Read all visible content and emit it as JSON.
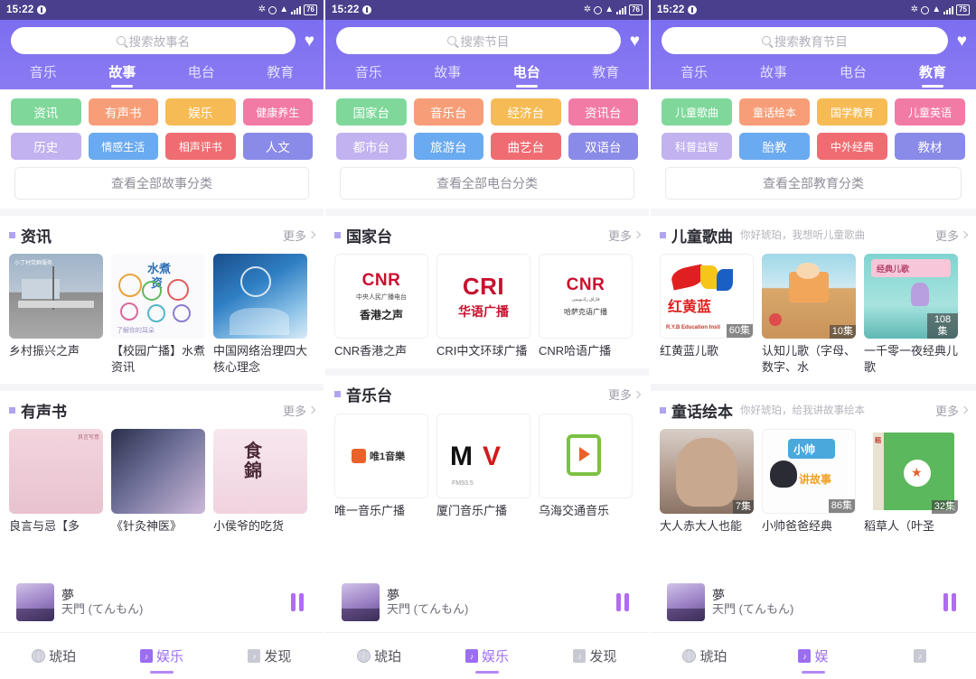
{
  "statusbar": {
    "time": "15:22",
    "battery_1": "76",
    "battery_2": "76",
    "battery_3": "75",
    "icons": [
      "info-icon",
      "bluetooth-icon",
      "alarm-icon",
      "wifi-icon",
      "signal-icon",
      "battery-icon"
    ]
  },
  "colors": {
    "header_purple": "#8b7bf2",
    "statusbar_purple": "#4a3f8c",
    "accent": "#9b6ef0",
    "chip_green": "#7fd89a",
    "chip_orange": "#f79e78",
    "chip_amber": "#f6bb54",
    "chip_pink": "#f27ba6",
    "chip_lavender": "#c3b2f0",
    "chip_blue": "#6aaaf0",
    "chip_red": "#ef6d72",
    "chip_indigo": "#8a8ae8"
  },
  "panels": [
    {
      "search_placeholder": "搜索故事名",
      "favorite_icon": "heart-icon",
      "tabs": [
        {
          "label": "音乐",
          "active": false
        },
        {
          "label": "故事",
          "active": true
        },
        {
          "label": "电台",
          "active": false
        },
        {
          "label": "教育",
          "active": false
        }
      ],
      "chips": [
        {
          "label": "资讯",
          "color": "#7fd89a"
        },
        {
          "label": "有声书",
          "color": "#f79e78"
        },
        {
          "label": "娱乐",
          "color": "#f6bb54"
        },
        {
          "label": "健康养生",
          "color": "#f27ba6"
        },
        {
          "label": "历史",
          "color": "#c3b2f0"
        },
        {
          "label": "情感生活",
          "color": "#6aaaf0"
        },
        {
          "label": "相声评书",
          "color": "#ef6d72"
        },
        {
          "label": "人文",
          "color": "#8a8ae8"
        }
      ],
      "view_all": "查看全部故事分类",
      "sections": [
        {
          "title": "资讯",
          "hint": "",
          "more": "更多",
          "cards": [
            {
              "title": "乡村振兴之声",
              "eps": ""
            },
            {
              "title": "【校园广播】水煮资讯",
              "eps": ""
            },
            {
              "title": "中国网络治理四大核心理念",
              "eps": ""
            }
          ]
        },
        {
          "title": "有声书",
          "hint": "",
          "more": "更多",
          "cards": [
            {
              "title": "良言与忌【多",
              "eps": ""
            },
            {
              "title": "《针灸神医》",
              "eps": ""
            },
            {
              "title": "小侯爷的吃货",
              "eps": ""
            }
          ]
        }
      ],
      "player": {
        "title": "夢",
        "artist": "天門 (てんもん)",
        "pause_icon": "pause-icon"
      },
      "bottomnav": [
        {
          "label": "琥珀",
          "icon": "globe-icon",
          "active": false
        },
        {
          "label": "娱乐",
          "icon": "book-icon",
          "active": true
        },
        {
          "label": "发现",
          "icon": "book-icon",
          "active": false
        }
      ]
    },
    {
      "search_placeholder": "搜索节目",
      "favorite_icon": "heart-icon",
      "tabs": [
        {
          "label": "音乐",
          "active": false
        },
        {
          "label": "故事",
          "active": false
        },
        {
          "label": "电台",
          "active": true
        },
        {
          "label": "教育",
          "active": false
        }
      ],
      "chips": [
        {
          "label": "国家台",
          "color": "#7fd89a"
        },
        {
          "label": "音乐台",
          "color": "#f79e78"
        },
        {
          "label": "经济台",
          "color": "#f6bb54"
        },
        {
          "label": "资讯台",
          "color": "#f27ba6"
        },
        {
          "label": "都市台",
          "color": "#c3b2f0"
        },
        {
          "label": "旅游台",
          "color": "#6aaaf0"
        },
        {
          "label": "曲艺台",
          "color": "#ef6d72"
        },
        {
          "label": "双语台",
          "color": "#8a8ae8"
        }
      ],
      "view_all": "查看全部电台分类",
      "sections": [
        {
          "title": "国家台",
          "hint": "",
          "more": "更多",
          "cards": [
            {
              "title": "CNR香港之声",
              "eps": "",
              "logo": "CNR",
              "sub": "中央人民广播电台",
              "sub2": "香港之声"
            },
            {
              "title": "CRI中文环球广播",
              "eps": "",
              "logo": "CRI",
              "sub": "华语广播"
            },
            {
              "title": "CNR哈语广播",
              "eps": "",
              "logo": "CNR",
              "sub": "哈萨克语广播"
            }
          ]
        },
        {
          "title": "音乐台",
          "hint": "",
          "more": "更多",
          "cards": [
            {
              "title": "唯一音乐广播",
              "eps": ""
            },
            {
              "title": "厦门音乐广播",
              "eps": ""
            },
            {
              "title": "乌海交通音乐",
              "eps": ""
            }
          ]
        }
      ],
      "player": {
        "title": "夢",
        "artist": "天門 (てんもん)",
        "pause_icon": "pause-icon"
      },
      "bottomnav": [
        {
          "label": "琥珀",
          "icon": "globe-icon",
          "active": false
        },
        {
          "label": "娱乐",
          "icon": "book-icon",
          "active": true
        },
        {
          "label": "发现",
          "icon": "book-icon",
          "active": false
        }
      ]
    },
    {
      "search_placeholder": "搜索教育节目",
      "favorite_icon": "heart-icon",
      "tabs": [
        {
          "label": "音乐",
          "active": false
        },
        {
          "label": "故事",
          "active": false
        },
        {
          "label": "电台",
          "active": false
        },
        {
          "label": "教育",
          "active": true
        }
      ],
      "chips": [
        {
          "label": "儿童歌曲",
          "color": "#7fd89a"
        },
        {
          "label": "童话绘本",
          "color": "#f79e78"
        },
        {
          "label": "国学教育",
          "color": "#f6bb54"
        },
        {
          "label": "儿童英语",
          "color": "#f27ba6"
        },
        {
          "label": "科普益智",
          "color": "#c3b2f0"
        },
        {
          "label": "胎教",
          "color": "#6aaaf0"
        },
        {
          "label": "中外经典",
          "color": "#ef6d72"
        },
        {
          "label": "教材",
          "color": "#8a8ae8"
        }
      ],
      "view_all": "查看全部教育分类",
      "sections": [
        {
          "title": "儿童歌曲",
          "hint": "你好琥珀，我想听儿童歌曲",
          "more": "更多",
          "cards": [
            {
              "title": "红黄蓝儿歌",
              "eps": "60集"
            },
            {
              "title": "认知儿歌（字母、数字、水",
              "eps": "10集"
            },
            {
              "title": "一千零一夜经典儿歌",
              "eps": "108集"
            }
          ]
        },
        {
          "title": "童话绘本",
          "hint": "你好琥珀，给我讲故事绘本",
          "more": "更多",
          "cards": [
            {
              "title": "大人赤大人也能",
              "eps": "7集"
            },
            {
              "title": "小帅爸爸经典",
              "eps": "86集"
            },
            {
              "title": "稻草人（叶圣",
              "eps": "32集"
            }
          ]
        }
      ],
      "player": {
        "title": "夢",
        "artist": "天門 (てんもん)",
        "pause_icon": "pause-icon"
      },
      "bottomnav": [
        {
          "label": "琥珀",
          "icon": "globe-icon",
          "active": false
        },
        {
          "label": "娱",
          "icon": "book-icon",
          "active": true
        },
        {
          "label": "",
          "icon": "book-icon",
          "active": false
        }
      ]
    }
  ]
}
